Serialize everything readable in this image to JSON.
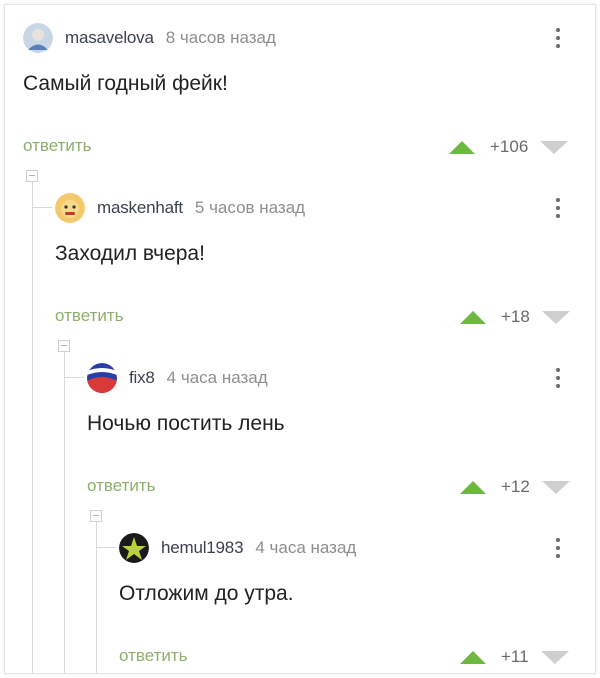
{
  "comments": [
    {
      "user": "masavelova",
      "time": "8 часов назад",
      "text": "Самый годный фейк!",
      "reply": "ответить",
      "rating": "+106"
    },
    {
      "user": "maskenhaft",
      "time": "5 часов назад",
      "text": "Заходил вчера!",
      "reply": "ответить",
      "rating": "+18"
    },
    {
      "user": "fix8",
      "time": "4 часа назад",
      "text": "Ночью постить лень",
      "reply": "ответить",
      "rating": "+12"
    },
    {
      "user": "hemul1983",
      "time": "4 часа назад",
      "text": "Отложим до утра.",
      "reply": "ответить",
      "rating": "+11"
    }
  ],
  "colors": {
    "upvote": "#6cb840",
    "downvote": "#cfcfcf",
    "reply": "#8cb06a"
  }
}
